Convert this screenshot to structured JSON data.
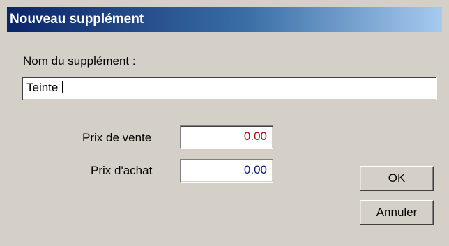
{
  "dialog": {
    "title": "Nouveau supplément"
  },
  "name_field": {
    "label": "Nom du supplément :",
    "value": "Teinte "
  },
  "prix_vente": {
    "label": "Prix de vente",
    "value": "0.00",
    "color": "#a01010"
  },
  "prix_achat": {
    "label": "Prix d'achat",
    "value": "0.00",
    "color": "#0a1a7a"
  },
  "buttons": {
    "ok": {
      "mnemonic": "O",
      "rest": "K"
    },
    "cancel": {
      "mnemonic": "A",
      "rest": "nnuler"
    }
  }
}
